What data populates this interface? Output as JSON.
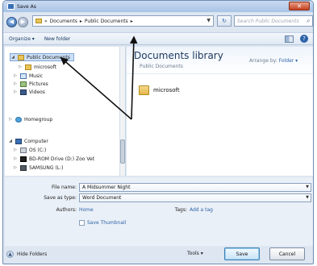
{
  "window": {
    "title": "Save As",
    "close_glyph": "✕"
  },
  "navigation": {
    "back_glyph": "◀",
    "forward_glyph": "▶",
    "address_crumbs": [
      "Documents",
      "Public Documents"
    ],
    "address_prefix": "«",
    "crumb_separator": "▸",
    "refresh_glyph": "↻",
    "search_placeholder": "Search Public Documents"
  },
  "toolbar": {
    "organize_label": "Organize ▾",
    "new_folder_label": "New folder"
  },
  "nav_tree": {
    "items": [
      {
        "label": "Public Documents",
        "icon": "folder-icon",
        "selected": true,
        "twisty": "◢"
      },
      {
        "label": "microsoft",
        "icon": "folder-icon",
        "twisty": "▷"
      },
      {
        "label": "Music",
        "icon": "music-icon",
        "twisty": "▷"
      },
      {
        "label": "Pictures",
        "icon": "pictures-icon",
        "twisty": "▷"
      },
      {
        "label": "Videos",
        "icon": "videos-icon",
        "twisty": "▷"
      },
      {
        "label": "Homegroup",
        "icon": "homegroup-icon",
        "twisty": "▷"
      },
      {
        "label": "Computer",
        "icon": "computer-icon",
        "twisty": "◢"
      },
      {
        "label": "OS (C:)",
        "icon": "disk-icon",
        "twisty": "▷"
      },
      {
        "label": "BD-ROM Drive (D:) Zoo Vet",
        "icon": "dvd-icon",
        "twisty": "▷"
      },
      {
        "label": "SAMSUNG (L:)",
        "icon": "usb-icon",
        "twisty": "▷"
      }
    ]
  },
  "library": {
    "title": "Documents library",
    "subtitle": "Public Documents",
    "arrange_label": "Arrange by:",
    "arrange_value": "Folder ▾",
    "files": [
      {
        "name": "microsoft",
        "icon": "folder-icon"
      }
    ]
  },
  "form": {
    "file_name_label": "File name:",
    "file_name_value": "A Midsummer Night",
    "save_type_label": "Save as type:",
    "save_type_value": "Word Document",
    "authors_label": "Authors:",
    "authors_value": "Home",
    "tags_label": "Tags:",
    "tags_value": "Add a tag",
    "thumbnail_label": "Save Thumbnail"
  },
  "footer": {
    "hide_folders_label": "Hide Folders",
    "tools_label": "Tools",
    "save_label": "Save",
    "cancel_label": "Cancel"
  }
}
